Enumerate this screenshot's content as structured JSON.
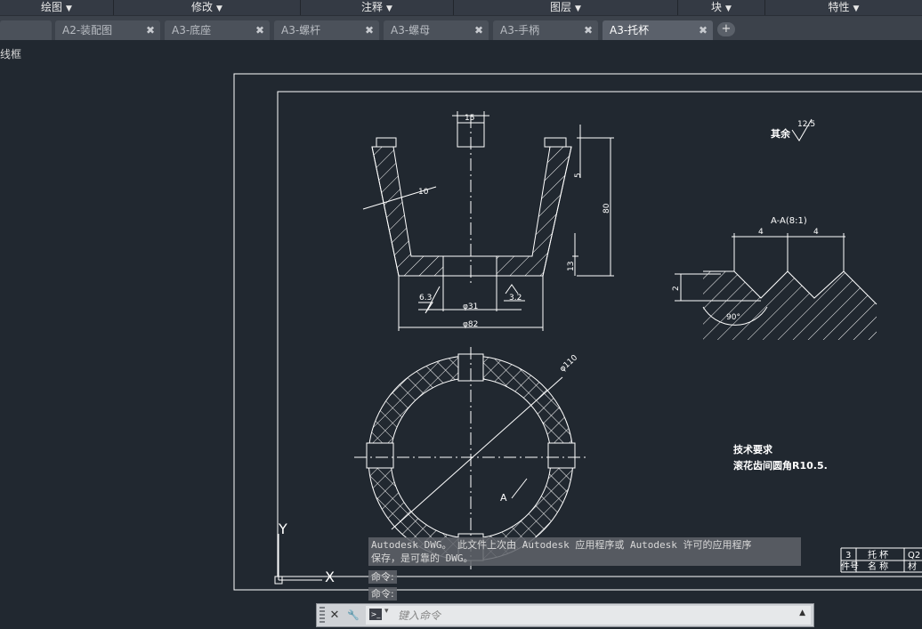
{
  "ribbon": {
    "panels": [
      "绘图",
      "修改",
      "注释",
      "图层",
      "块",
      "特性"
    ],
    "caret": "▼"
  },
  "tabs": [
    {
      "label": "A2-装配图",
      "close": "✖"
    },
    {
      "label": "A3-底座",
      "close": "✖"
    },
    {
      "label": "A3-螺杆",
      "close": "✖"
    },
    {
      "label": "A3-螺母",
      "close": "✖"
    },
    {
      "label": "A3-手柄",
      "close": "✖"
    },
    {
      "label": "A3-托杯",
      "close": "✖",
      "active": true
    }
  ],
  "tab_add": "+",
  "viewport_label": "线框",
  "drawing": {
    "dims": {
      "top_width": "15",
      "wall_thickness": "10",
      "lip": "5",
      "height": "80",
      "base_thickness": "13",
      "roughness_left": "6.3",
      "roughness_right": "3.2",
      "bore_diameter": "φ31",
      "base_diameter": "φ82",
      "outer_diameter": "φ110"
    },
    "surface_note": "其余",
    "surface_value": "12.5",
    "section_title": "A-A(8:1)",
    "section_pitch_left": "4",
    "section_pitch_right": "4",
    "section_depth": "2",
    "section_angle": "90°",
    "view_marker": "A",
    "tech_title": "技术要求",
    "tech_note": "滚花齿间圆角R10.5.",
    "title_block": {
      "row1": [
        "3",
        "托 杯",
        "Q2"
      ],
      "row2": [
        "件号",
        "名 称",
        "材"
      ]
    },
    "ucs_y": "Y",
    "ucs_x": "X"
  },
  "command": {
    "history_line1": "Autodesk DWG。  此文件上次由 Autodesk 应用程序或 Autodesk 许可的应用程序",
    "history_line2": "保存，是可靠的 DWG。",
    "prompt1": "命令:",
    "prompt2": "命令:",
    "placeholder": "键入命令",
    "close_icon": "✕",
    "settings_icon": "🔧",
    "prompt_icon": ">_",
    "up_icon": "▲"
  }
}
